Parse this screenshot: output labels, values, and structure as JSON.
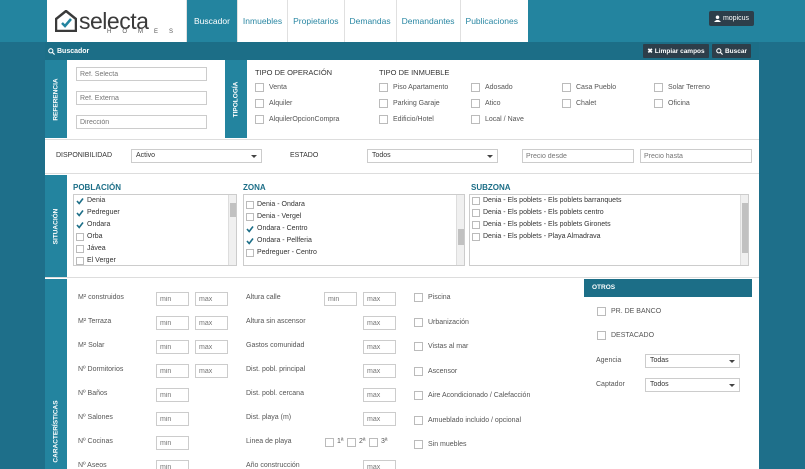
{
  "header": {
    "logo_text": "selecta",
    "logo_sub": "HOMES",
    "nav": [
      "Buscador",
      "Inmuebles",
      "Propietarios",
      "Demandas",
      "Demandantes",
      "Publicaciones"
    ],
    "user": "mopicus"
  },
  "searchbar": {
    "title": "Buscador",
    "clear": "Limpiar campos",
    "search": "Buscar"
  },
  "referencia": {
    "label": "REFERENCIA",
    "fields": [
      "Ref. Selecta",
      "Ref. Externa",
      "Dirección"
    ]
  },
  "tipologia": {
    "label": "TIPOLOGÍA",
    "op_title": "TIPO DE OPERACIÓN",
    "ops": [
      "Venta",
      "Alquiler",
      "AlquilerOpcionCompra"
    ],
    "inm_title": "TIPO DE INMUEBLE",
    "inm": [
      "Piso Apartamento",
      "Adosado",
      "Casa Pueblo",
      "Solar Terreno",
      "Parking Garaje",
      "Atico",
      "Chalet",
      "Oficina",
      "Edificio/Hotel",
      "Local / Nave"
    ]
  },
  "filters": {
    "disp_label": "DISPONIBILIDAD",
    "disp_value": "Activo",
    "estado_label": "ESTADO",
    "estado_value": "Todos",
    "price_from": "Precio desde",
    "price_to": "Precio hasta"
  },
  "situacion": {
    "label": "SITUACIÓN",
    "poblacion_title": "POBLACIÓN",
    "poblacion": [
      {
        "t": "Denia",
        "c": true
      },
      {
        "t": "Pedreguer",
        "c": true
      },
      {
        "t": "Ondara",
        "c": true
      },
      {
        "t": "Orba",
        "c": false
      },
      {
        "t": "Jávea",
        "c": false
      },
      {
        "t": "El Verger",
        "c": false
      }
    ],
    "zona_title": "ZONA",
    "zona": [
      {
        "t": "Denia - Ondara",
        "c": false
      },
      {
        "t": "Denia - Vergel",
        "c": false
      },
      {
        "t": "Ondara - Centro",
        "c": true
      },
      {
        "t": "Ondara - Pellferia",
        "c": true
      },
      {
        "t": "Pedreguer - Centro",
        "c": false
      }
    ],
    "subzona_title": "SUBZONA",
    "subzona": [
      "Denia - Els poblets - Els poblets barranquets",
      "Denia - Els poblets - Els poblets centro",
      "Denia - Els poblets - Els poblets Gironets",
      "Denia - Els poblets - Playa Almadrava"
    ]
  },
  "caracteristicas": {
    "label": "CARACTERÍSTICAS",
    "min": "min",
    "max": "max",
    "col1": [
      "M² construidos",
      "M² Terraza",
      "M² Solar",
      "Nº Dormitorios",
      "Nº Baños",
      "Nº Salones",
      "Nº Cocinas",
      "Nº Aseos"
    ],
    "col2": [
      "Altura calle",
      "Altura sin ascensor",
      "Gastos comunidad",
      "Dist. pobl. principal",
      "Dist. pobl. cercana",
      "Dist. playa (m)",
      "Linea de playa",
      "Año construcción"
    ],
    "linea": [
      "1ª",
      "2ª",
      "3ª"
    ],
    "checks": [
      "Piscina",
      "Urbanización",
      "Vistas al mar",
      "Ascensor",
      "Aire Acondicionado / Calefacción",
      "Amueblado incluido / opcional",
      "Sin muebles"
    ]
  },
  "otros": {
    "title": "OTROS",
    "checks": [
      "PR. DE BANCO",
      "DESTACADO"
    ],
    "agencia_label": "Agencia",
    "agencia_value": "Todas",
    "captador_label": "Captador",
    "captador_value": "Todos"
  }
}
